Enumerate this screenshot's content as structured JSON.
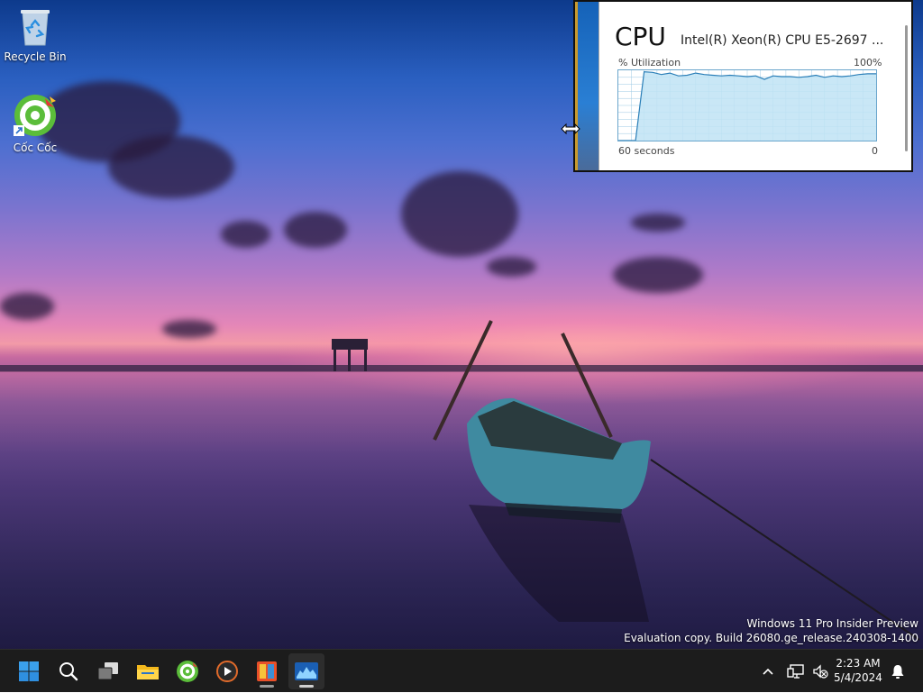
{
  "desktop": {
    "icons": [
      {
        "label": "Recycle Bin",
        "icon": "recycle-bin-icon"
      },
      {
        "label": "Cốc Cốc",
        "icon": "coccoc-icon"
      }
    ],
    "watermark": {
      "line1": "Windows 11 Pro Insider Preview",
      "line2": "Evaluation copy. Build 26080.ge_release.240308-1400"
    }
  },
  "cpu_widget": {
    "title": "CPU",
    "model": "Intel(R) Xeon(R) CPU E5-2697 ...",
    "util_label": "% Utilization",
    "util_max": "100%",
    "time_label": "60 seconds",
    "time_end": "0",
    "colors": {
      "line": "#2b7fb8",
      "fill": "#bfe3f5",
      "grid": "#9cc9e4"
    },
    "chart_data": {
      "type": "area",
      "x": [
        60,
        58,
        56,
        54,
        52,
        50,
        48,
        46,
        44,
        42,
        40,
        38,
        36,
        34,
        32,
        30,
        28,
        26,
        24,
        22,
        20,
        18,
        16,
        14,
        12,
        10,
        8,
        6,
        4,
        2,
        0
      ],
      "y": [
        0,
        0,
        0,
        98,
        97,
        94,
        96,
        92,
        93,
        96,
        94,
        93,
        92,
        93,
        92,
        91,
        92,
        87,
        92,
        91,
        91,
        90,
        91,
        93,
        90,
        92,
        91,
        92,
        94,
        95,
        95
      ],
      "ylim": [
        0,
        100
      ],
      "xlabel": "60 seconds",
      "ylabel": "% Utilization",
      "grid": true
    }
  },
  "taskbar": {
    "items": [
      {
        "name": "start-button",
        "icon": "windows-icon"
      },
      {
        "name": "search-button",
        "icon": "search-icon"
      },
      {
        "name": "task-view-button",
        "icon": "task-view-icon"
      },
      {
        "name": "file-explorer-button",
        "icon": "folder-icon"
      },
      {
        "name": "coccoc-button",
        "icon": "coccoc-icon"
      },
      {
        "name": "media-player-button",
        "icon": "media-player-icon"
      },
      {
        "name": "app-store-button",
        "icon": "store-icon"
      },
      {
        "name": "task-manager-button",
        "icon": "performance-icon"
      }
    ],
    "tray": {
      "time": "2:23 AM",
      "date": "5/4/2024"
    }
  }
}
